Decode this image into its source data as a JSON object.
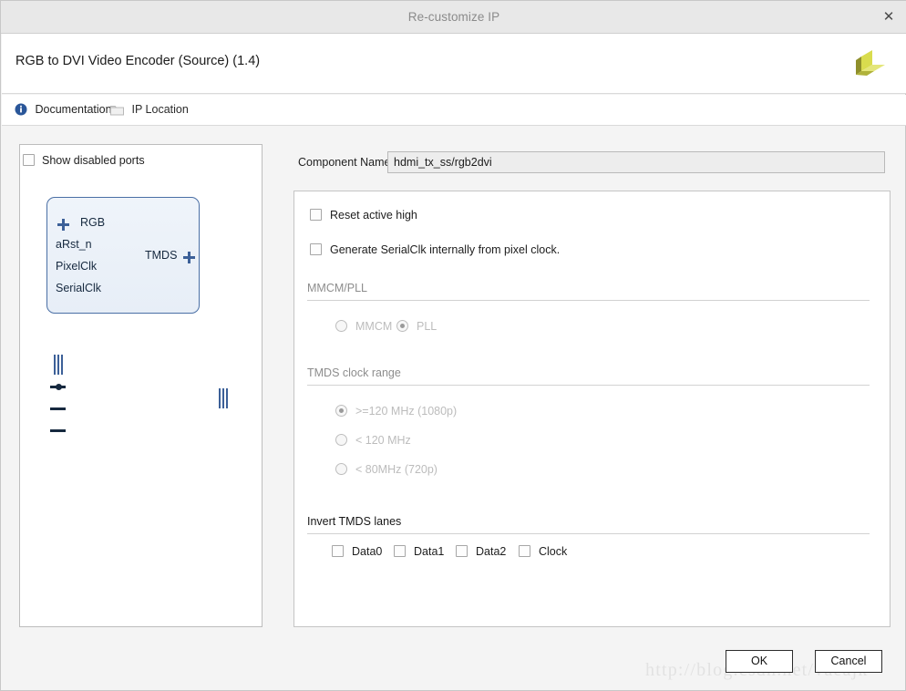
{
  "window": {
    "title": "Re-customize IP",
    "close_icon": "close-icon",
    "close_glyph": "✕"
  },
  "header": {
    "ip_title": "RGB to DVI Video Encoder (Source) (1.4)",
    "logo_icon": "xilinx-logo-icon"
  },
  "linkbar": {
    "documentation": {
      "label": "Documentation",
      "icon": "info-circle-icon"
    },
    "ip_location": {
      "label": "IP Location",
      "icon": "folder-icon"
    }
  },
  "diagram": {
    "show_disabled_ports": {
      "label": "Show disabled ports",
      "checked": false
    },
    "block": {
      "inputs": [
        {
          "name": "RGB",
          "connector": "bus-plus"
        },
        {
          "name": "aRst_n",
          "connector": "inverted-pin"
        },
        {
          "name": "PixelClk",
          "connector": "pin"
        },
        {
          "name": "SerialClk",
          "connector": "pin"
        }
      ],
      "outputs": [
        {
          "name": "TMDS",
          "connector": "bus-plus"
        }
      ]
    }
  },
  "form": {
    "component_name": {
      "label": "Component Name",
      "value": "hdmi_tx_ss/rgb2dvi",
      "placeholder": ""
    },
    "checkboxes": [
      {
        "label": "Reset active high",
        "checked": false
      },
      {
        "label": "Generate SerialClk internally from pixel clock.",
        "checked": false
      }
    ],
    "sections": [
      {
        "title": "MMCM/PLL",
        "disabled": true,
        "options": [
          {
            "label": "MMCM",
            "selected": false
          },
          {
            "label": "PLL",
            "selected": true
          }
        ]
      },
      {
        "title": "TMDS clock range",
        "disabled": true,
        "options": [
          {
            "label": ">=120 MHz (1080p)",
            "selected": true
          },
          {
            "label": "< 120 MHz",
            "selected": false
          },
          {
            "label": "< 80MHz (720p)",
            "selected": false
          }
        ]
      },
      {
        "title": "Invert TMDS lanes",
        "disabled": false,
        "lanes": [
          {
            "label": "Data0",
            "checked": false
          },
          {
            "label": "Data1",
            "checked": false
          },
          {
            "label": "Data2",
            "checked": false
          },
          {
            "label": "Clock",
            "checked": false
          }
        ]
      }
    ]
  },
  "footer": {
    "ok_label": "OK",
    "cancel_label": "Cancel",
    "watermark": "http://blog.csdn.net/vaeajk"
  },
  "colors": {
    "titlebar_bg": "#e8e8e8",
    "dialog_bg": "#f4f4f4",
    "block_border": "#4a6fa5",
    "block_fill": "#eff4fa",
    "connector_blue": "#3c6098",
    "brand_yellow": "#d4d646",
    "brand_olive": "#8f8f2b",
    "info_blue": "#2a5699",
    "disabled_text": "#bcbcbc"
  }
}
